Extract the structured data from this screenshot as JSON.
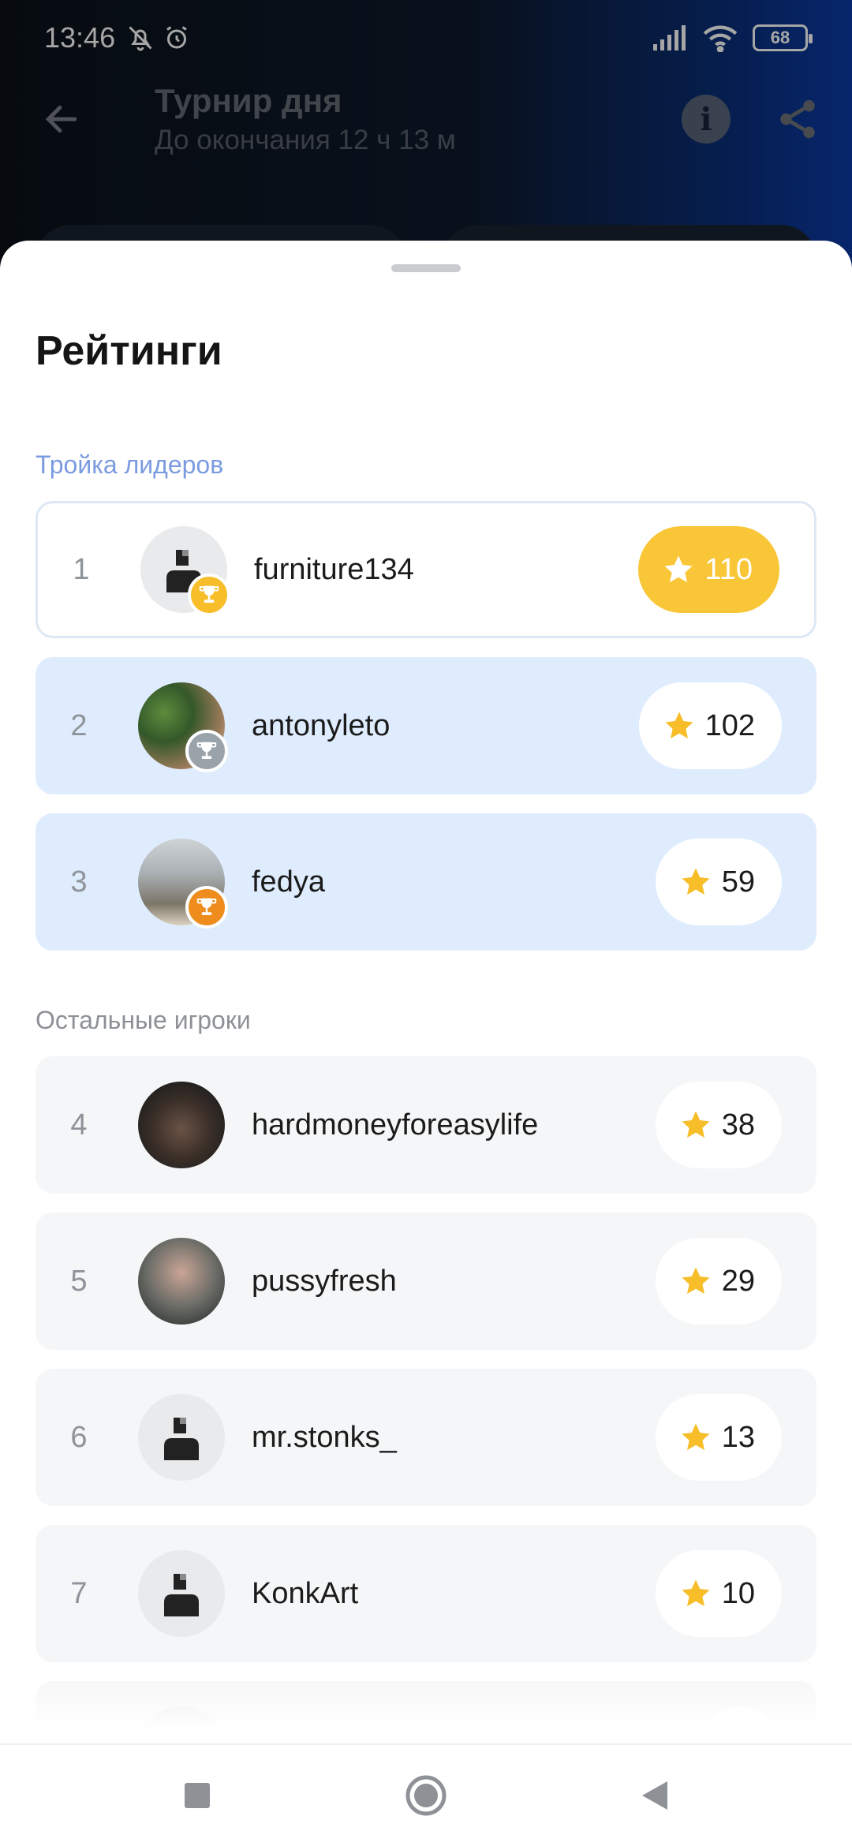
{
  "status": {
    "time": "13:46",
    "battery": "68",
    "icons": [
      "bell-off-icon",
      "alarm-icon",
      "signal-icon",
      "wifi-icon",
      "battery-icon"
    ]
  },
  "header": {
    "title": "Турнир дня",
    "subtitle": "До окончания 12 ч 13 м",
    "icons": [
      "back-arrow-icon",
      "info-icon",
      "share-icon"
    ]
  },
  "sheet": {
    "title": "Рейтинги",
    "top_label": "Тройка лидеров",
    "rest_label": "Остальные игроки"
  },
  "leaders": [
    {
      "rank": "1",
      "name": "furniture134",
      "score": "110",
      "trophy": "gold",
      "avatar": "default"
    },
    {
      "rank": "2",
      "name": "antonyleto",
      "score": "102",
      "trophy": "silver",
      "avatar": "photo"
    },
    {
      "rank": "3",
      "name": "fedya",
      "score": "59",
      "trophy": "bronze",
      "avatar": "photo"
    }
  ],
  "others": [
    {
      "rank": "4",
      "name": "hardmoneyforeasylife",
      "score": "38",
      "avatar": "photo"
    },
    {
      "rank": "5",
      "name": "pussyfresh",
      "score": "29",
      "avatar": "photo"
    },
    {
      "rank": "6",
      "name": "mr.stonks_",
      "score": "13",
      "avatar": "default"
    },
    {
      "rank": "7",
      "name": "KonkArt",
      "score": "10",
      "avatar": "default"
    }
  ],
  "colors": {
    "accent_yellow": "#f9c637",
    "leader_row": "#dfecfd",
    "rest_row": "#f5f6f7",
    "section_blue": "#7b9be0",
    "gold": "#f7be2a",
    "silver": "#9aa2aa",
    "bronze": "#ee8d1e"
  },
  "navbar": {
    "icons": [
      "recents-square-icon",
      "home-circle-icon",
      "back-triangle-icon"
    ]
  }
}
